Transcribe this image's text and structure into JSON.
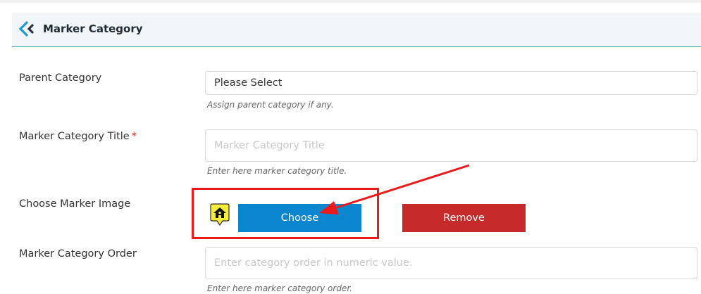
{
  "panel": {
    "title": "Marker Category",
    "icon": "brand-logo-icon"
  },
  "form": {
    "parent_category": {
      "label": "Parent Category",
      "value": "Please Select",
      "hint": "Assign parent category if any."
    },
    "title": {
      "label": "Marker Category Title",
      "required_mark": "*",
      "placeholder": "Marker Category Title",
      "hint": "Enter here marker category title."
    },
    "image": {
      "label": "Choose Marker Image",
      "preview_icon": "home-marker-icon",
      "choose_label": "Choose",
      "remove_label": "Remove"
    },
    "order": {
      "label": "Marker Category Order",
      "placeholder": "Enter category order in numeric value.",
      "hint": "Enter here marker category order."
    }
  },
  "colors": {
    "accent_border": "#2bb0a8",
    "choose_button": "#0a86cf",
    "remove_button": "#c62a2a",
    "annotation": "#ec1b1b",
    "required": "#e0281e"
  }
}
